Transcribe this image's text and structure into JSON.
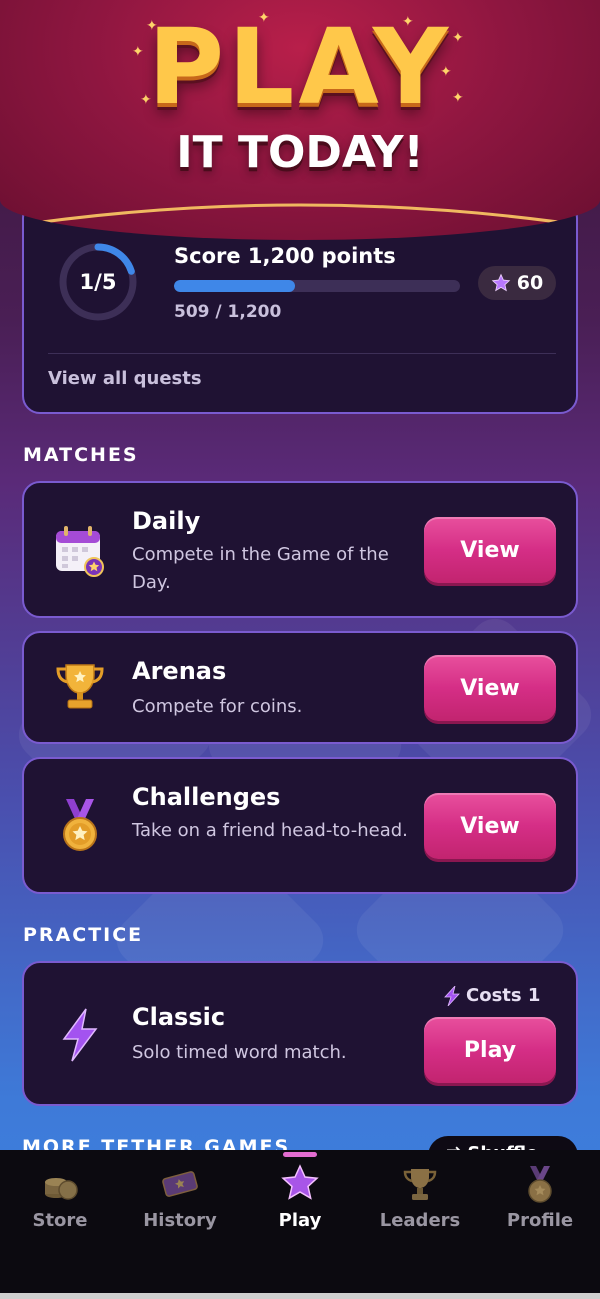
{
  "hero": {
    "title": "PLAY",
    "subtitle": "IT TODAY!"
  },
  "quest": {
    "ring_label": "1/5",
    "ring_progress": 0.2,
    "title": "Score 1,200 points",
    "progress_text": "509 / 1,200",
    "progress_fraction": 0.424,
    "reward": "60",
    "link": "View all quests"
  },
  "sections": {
    "matches": "MATCHES",
    "practice": "PRACTICE",
    "more": "MORE TETHER GAMES"
  },
  "matches": [
    {
      "title": "Daily",
      "desc": "Compete in the Game of the Day.",
      "button": "View",
      "icon": "calendar-icon"
    },
    {
      "title": "Arenas",
      "desc": "Compete for coins.",
      "button": "View",
      "icon": "trophy-icon"
    },
    {
      "title": "Challenges",
      "desc": "Take on a friend head-to-head.",
      "button": "View",
      "icon": "medal-icon"
    }
  ],
  "practice": {
    "title": "Classic",
    "desc": "Solo timed word match.",
    "button": "Play",
    "cost": "Costs 1",
    "icon": "lightning-icon"
  },
  "shuffle": {
    "label": "Shuffle"
  },
  "tabs": [
    {
      "label": "Store",
      "icon": "coins-icon"
    },
    {
      "label": "History",
      "icon": "ticket-icon"
    },
    {
      "label": "Play",
      "icon": "star-icon"
    },
    {
      "label": "Leaders",
      "icon": "trophy-icon"
    },
    {
      "label": "Profile",
      "icon": "medal-icon"
    }
  ],
  "colors": {
    "accent_pink": "#d52e86",
    "card_bg": "#1f1233",
    "card_border": "#7a5bd0",
    "progress_blue": "#3f87e8",
    "hero_gold": "#ffc84a"
  }
}
